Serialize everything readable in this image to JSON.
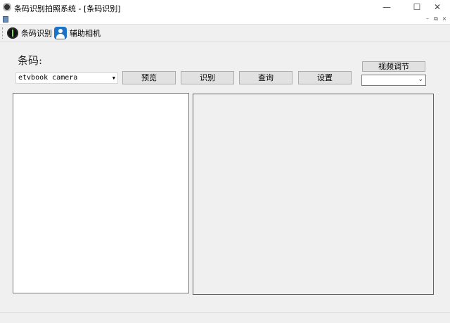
{
  "window": {
    "title": "条码识别拍照系统 - [条码识别]",
    "minimize_glyph": "—",
    "maximize_glyph": "☐",
    "close_glyph": "✕"
  },
  "mdi": {
    "minimize_glyph": "–",
    "restore_glyph": "⧉",
    "close_glyph": "×"
  },
  "toolbar": {
    "items": [
      {
        "label": "条码识别",
        "icon": "barcode-scanner-icon"
      },
      {
        "label": "辅助相机",
        "icon": "user-camera-icon"
      }
    ]
  },
  "main": {
    "barcode_label": "条码:",
    "camera_select_value": "etvbook camera",
    "buttons": {
      "preview": "预览",
      "recognize": "识别",
      "query": "查询",
      "settings": "设置"
    },
    "video_adjust_label": "视频调节",
    "video_select_value": ""
  }
}
